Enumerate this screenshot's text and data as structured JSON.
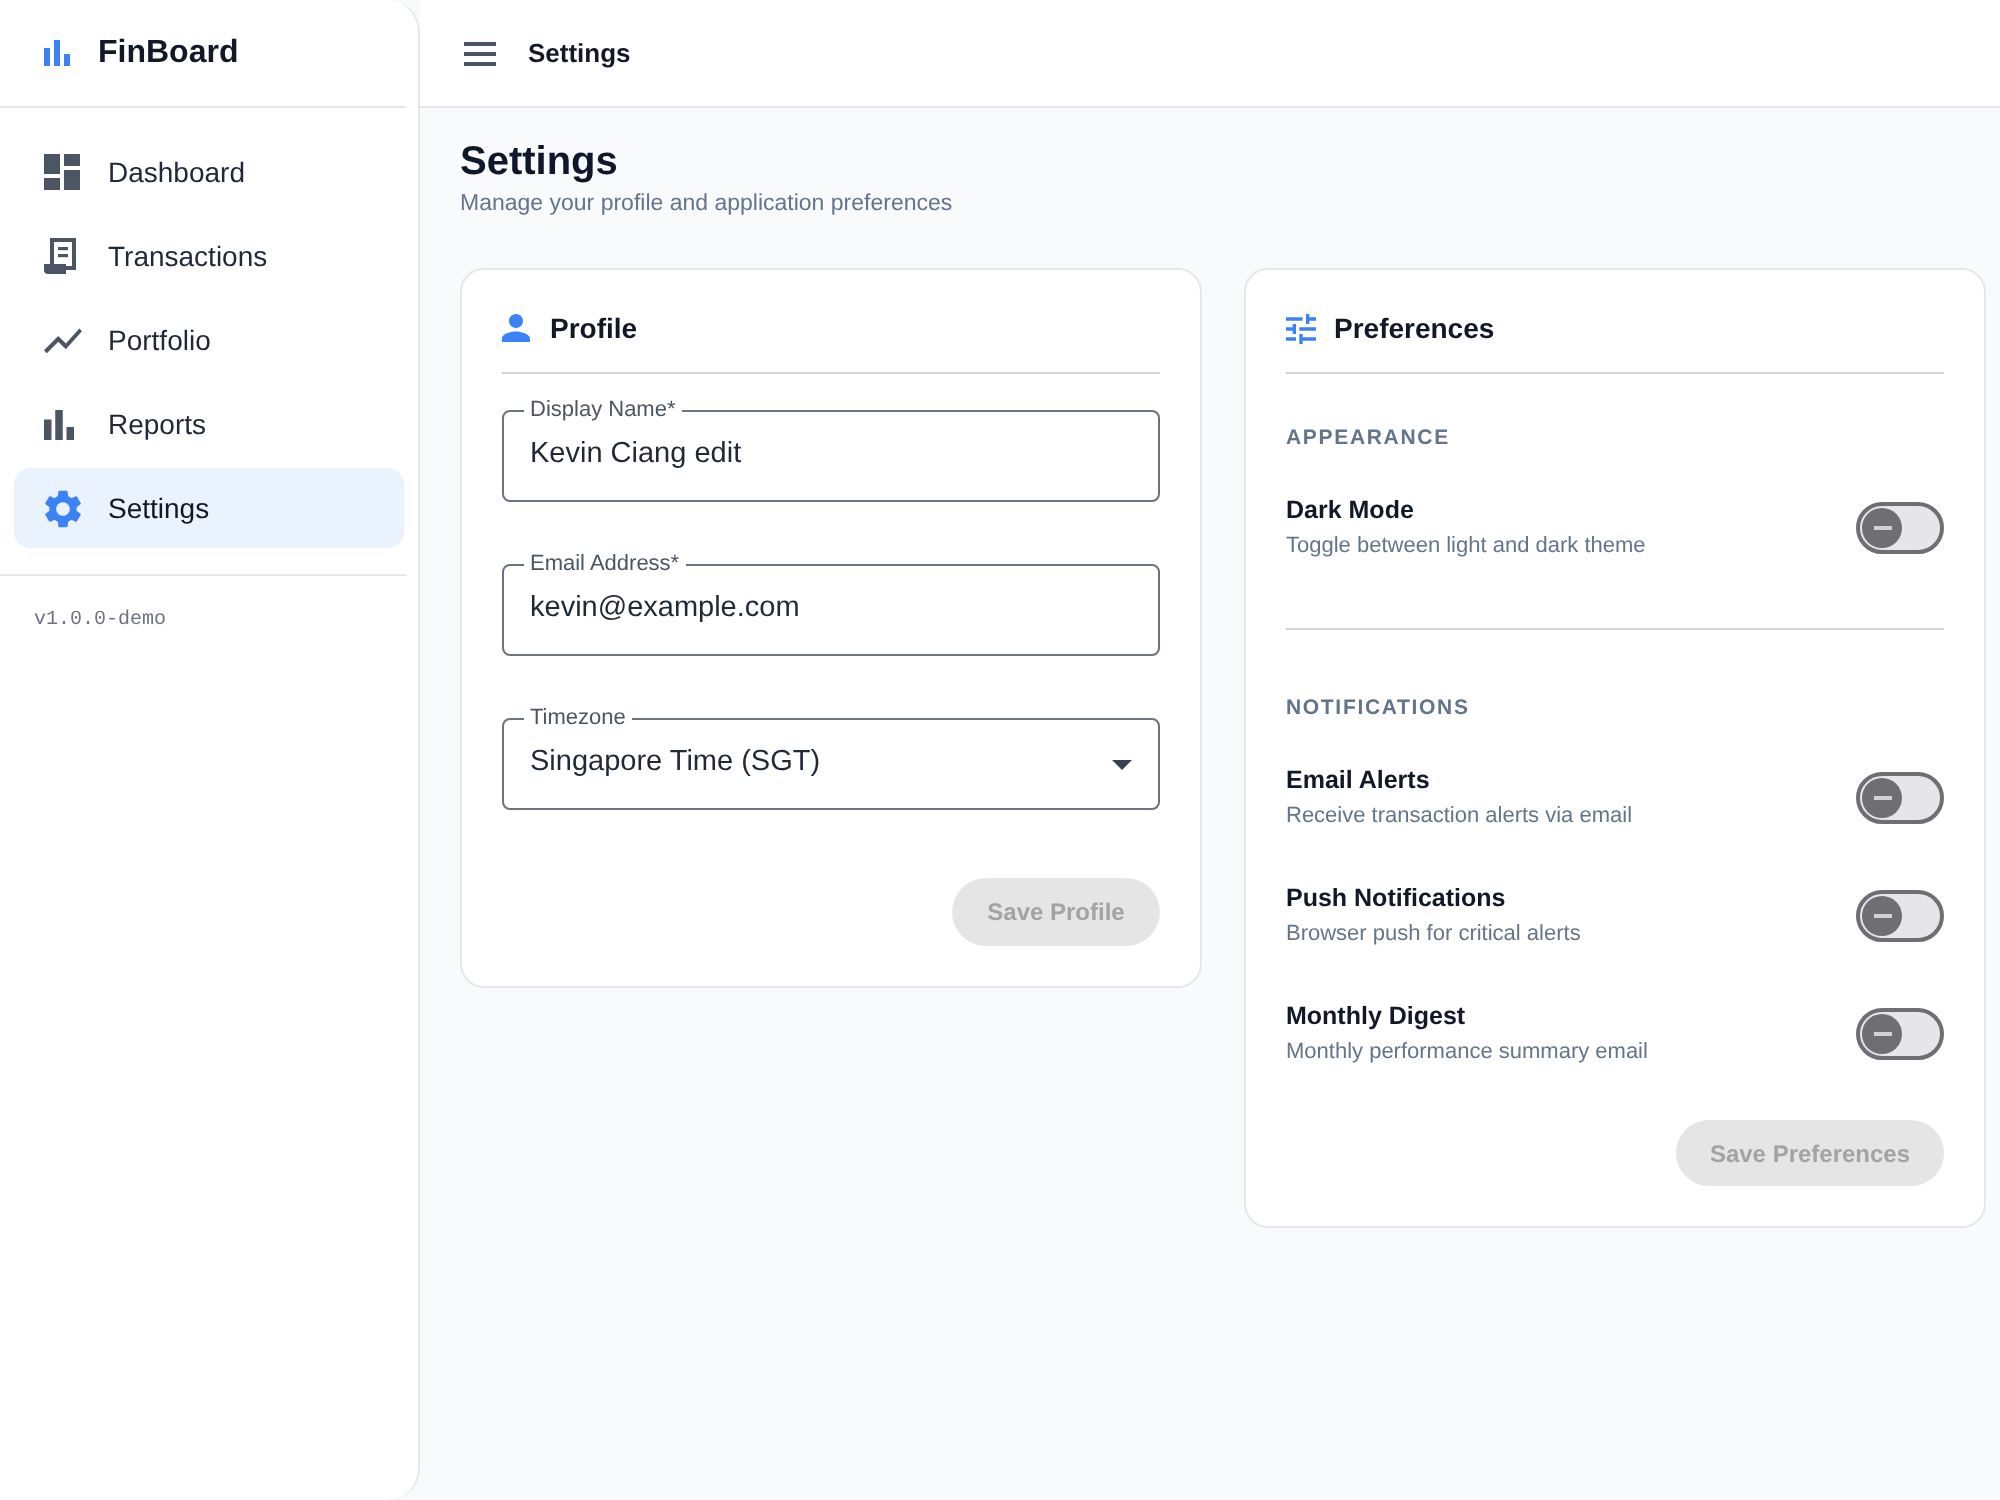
{
  "app": {
    "name": "FinBoard"
  },
  "sidebar": {
    "items": [
      {
        "label": "Dashboard",
        "selected": false
      },
      {
        "label": "Transactions",
        "selected": false
      },
      {
        "label": "Portfolio",
        "selected": false
      },
      {
        "label": "Reports",
        "selected": false
      },
      {
        "label": "Settings",
        "selected": true
      }
    ],
    "version": "v1.0.0-demo"
  },
  "top_bar": {
    "title": "Settings"
  },
  "page": {
    "title": "Settings",
    "subtitle": "Manage your profile and application preferences"
  },
  "profile": {
    "title": "Profile",
    "fields": [
      {
        "kind": "text",
        "label": "Display Name*",
        "value": "Kevin Ciang edit"
      },
      {
        "kind": "text",
        "label": "Email Address*",
        "value": "kevin@example.com"
      },
      {
        "kind": "select",
        "label": "Timezone",
        "value": "Singapore Time (SGT)"
      }
    ],
    "save_button": {
      "label": "Save Profile",
      "disabled": true
    }
  },
  "preferences": {
    "title": "Preferences",
    "sections": [
      {
        "heading": "APPEARANCE",
        "items": [
          {
            "label": "Dark Mode",
            "description": "Toggle between light and dark theme",
            "on": false
          }
        ]
      },
      {
        "heading": "NOTIFICATIONS",
        "items": [
          {
            "label": "Email Alerts",
            "description": "Receive transaction alerts via email",
            "on": false
          },
          {
            "label": "Push Notifications",
            "description": "Browser push for critical alerts",
            "on": false
          },
          {
            "label": "Monthly Digest",
            "description": "Monthly performance summary email",
            "on": false
          }
        ]
      }
    ],
    "save_button": {
      "label": "Save Preferences",
      "disabled": true
    }
  }
}
